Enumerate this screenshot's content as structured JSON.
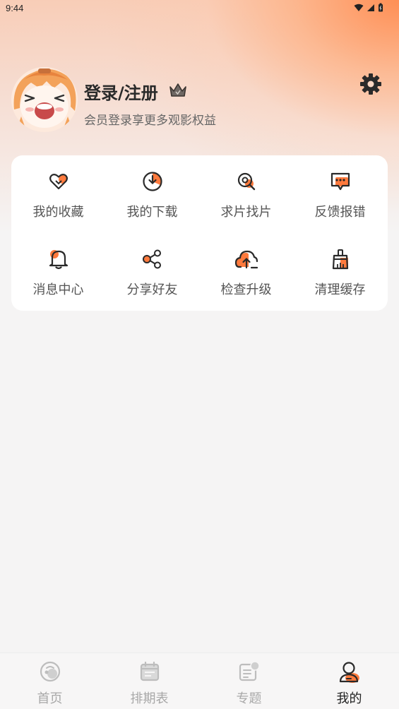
{
  "status_bar": {
    "time": "9:44"
  },
  "profile": {
    "title": "登录/注册",
    "subtitle": "会员登录享更多观影权益"
  },
  "menu": [
    {
      "label": "我的收藏",
      "icon": "heart-icon"
    },
    {
      "label": "我的下载",
      "icon": "download-icon"
    },
    {
      "label": "求片找片",
      "icon": "search-film-icon"
    },
    {
      "label": "反馈报错",
      "icon": "feedback-icon"
    },
    {
      "label": "消息中心",
      "icon": "bell-icon"
    },
    {
      "label": "分享好友",
      "icon": "share-icon"
    },
    {
      "label": "检查升级",
      "icon": "cloud-upload-icon"
    },
    {
      "label": "清理缓存",
      "icon": "broom-icon"
    }
  ],
  "tabs": [
    {
      "label": "首页",
      "icon": "home-icon",
      "active": false
    },
    {
      "label": "排期表",
      "icon": "calendar-icon",
      "active": false
    },
    {
      "label": "专题",
      "icon": "topic-icon",
      "active": false
    },
    {
      "label": "我的",
      "icon": "profile-icon",
      "active": true
    }
  ],
  "colors": {
    "accent": "#ff7a3d",
    "icon_dark": "#2a2a2a",
    "inactive": "#a8a8a8"
  }
}
